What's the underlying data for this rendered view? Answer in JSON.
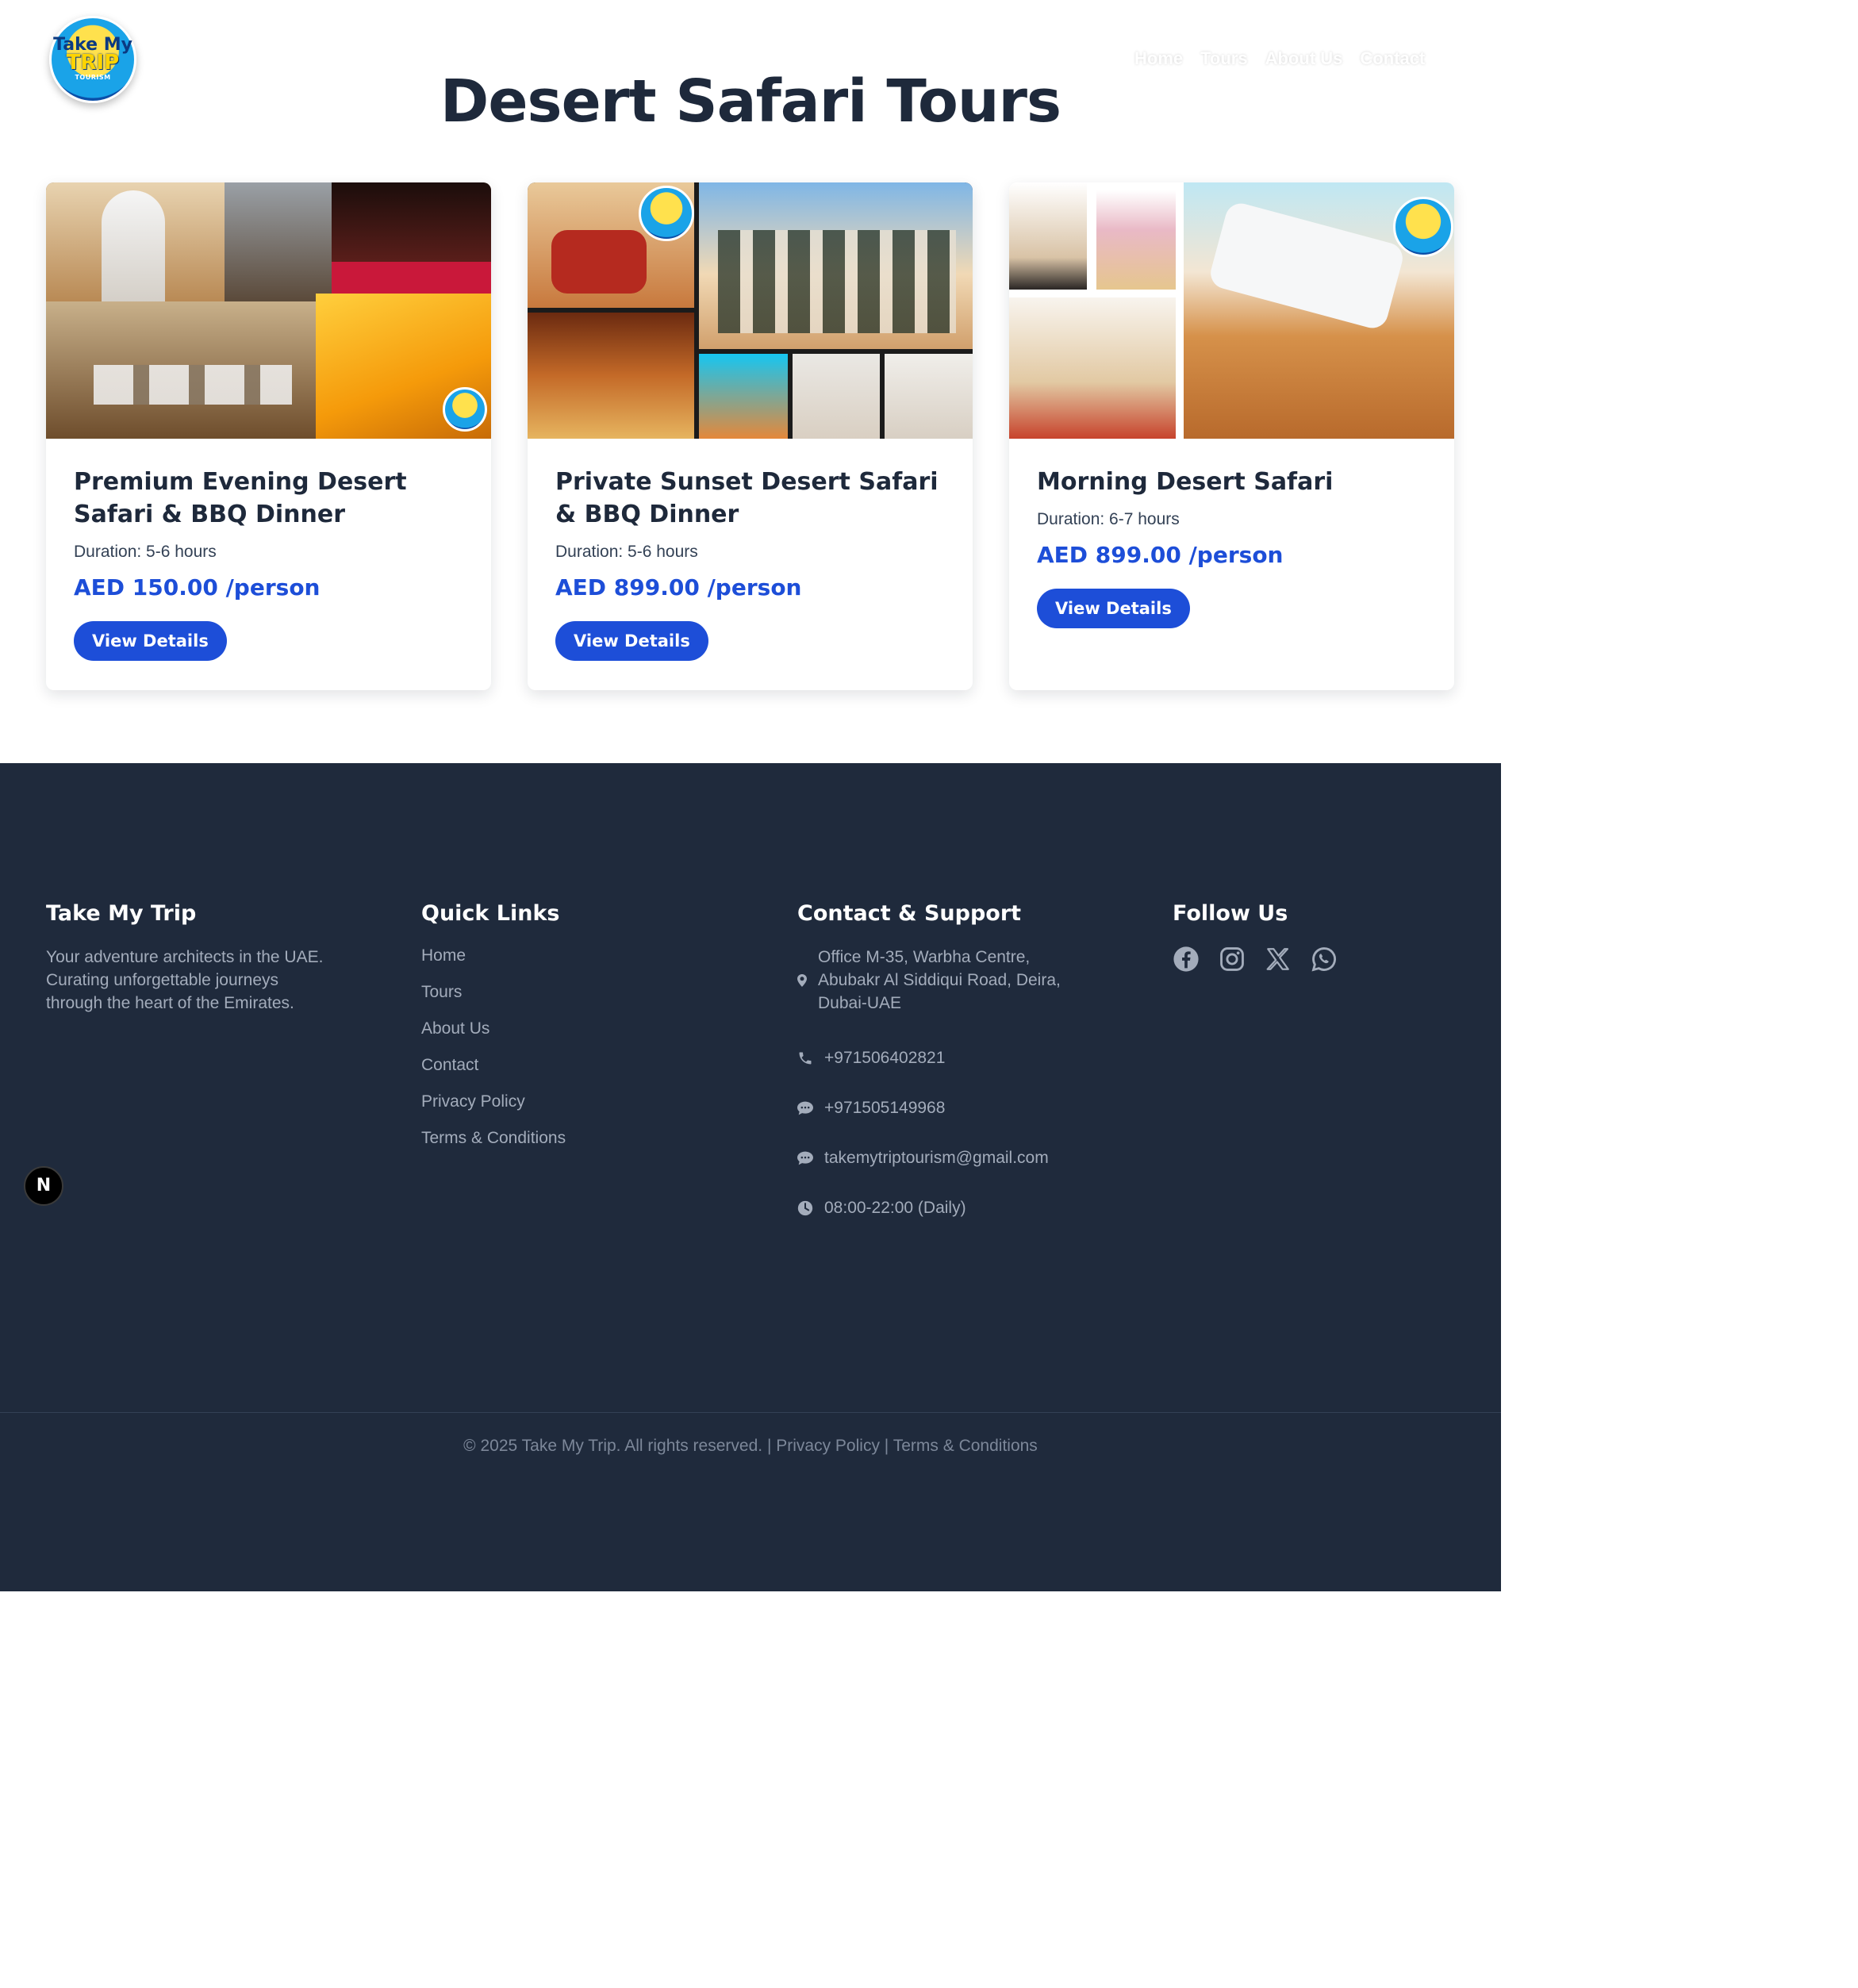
{
  "header": {
    "logo": {
      "line1": "Take My",
      "line2": "TRIP",
      "line3": "TOURISM"
    },
    "nav": [
      "Home",
      "Tours",
      "About Us",
      "Contact"
    ],
    "title": "Desert Safari Tours"
  },
  "tours": [
    {
      "name": "Premium Evening Desert Safari & BBQ Dinner",
      "duration": "Duration: 5-6 hours",
      "price": "AED 150.00 /person",
      "button": "View Details"
    },
    {
      "name": "Private Sunset Desert Safari & BBQ Dinner",
      "duration": "Duration: 5-6 hours",
      "price": "AED 899.00 /person",
      "button": "View Details"
    },
    {
      "name": "Morning Desert Safari",
      "duration": "Duration: 6-7 hours",
      "price": "AED 899.00 /person",
      "button": "View Details"
    }
  ],
  "footer": {
    "brand": {
      "title": "Take My Trip",
      "description": "Your adventure architects in the UAE. Curating unforgettable journeys through the heart of the Emirates."
    },
    "quick_links": {
      "title": "Quick Links",
      "items": [
        "Home",
        "Tours",
        "About Us",
        "Contact",
        "Privacy Policy",
        "Terms & Conditions"
      ]
    },
    "contact": {
      "title": "Contact & Support",
      "address": "Office M-35, Warbha Centre, Abubakr Al Siddiqui Road, Deira, Dubai-UAE",
      "phone": "+971506402821",
      "whatsapp": "+971505149968",
      "email": "takemytriptourism@gmail.com",
      "hours": "08:00-22:00 (Daily)"
    },
    "follow": {
      "title": "Follow Us",
      "icons": [
        "facebook-icon",
        "instagram-icon",
        "x-icon",
        "whatsapp-icon"
      ]
    },
    "copyright": "© 2025 Take My Trip. All rights reserved.",
    "sep": "|",
    "privacy": "Privacy Policy",
    "terms": "Terms & Conditions"
  },
  "badge": "N",
  "colors": {
    "primary": "#1d4ed8",
    "footer_bg": "#1f2a3c",
    "heading": "#1e293b"
  }
}
